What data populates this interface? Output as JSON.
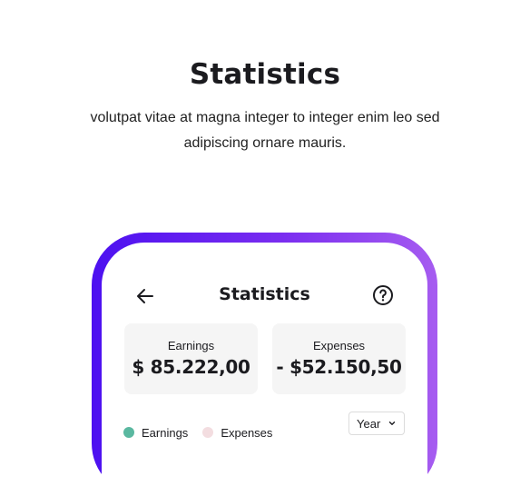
{
  "hero": {
    "title": "Statistics",
    "subtitle": "volutpat vitae at magna integer to integer enim leo sed adipiscing ornare mauris."
  },
  "phone": {
    "nav": {
      "title": "Statistics",
      "back_icon": "arrow-left-icon",
      "help_icon": "question-circle-icon"
    },
    "cards": [
      {
        "label": "Earnings",
        "value": "$ 85.222,00"
      },
      {
        "label": "Expenses",
        "value": "- $52.150,50"
      }
    ],
    "legend": [
      {
        "label": "Earnings",
        "color": "#5ab8a0"
      },
      {
        "label": "Expenses",
        "color": "#f3dde0"
      }
    ],
    "period_select": {
      "value": "Year",
      "icon": "chevron-down-icon"
    }
  },
  "colors": {
    "frame_gradient_start": "#4c10f0",
    "frame_gradient_end": "#a65cf0",
    "card_bg": "#f5f5f5"
  }
}
